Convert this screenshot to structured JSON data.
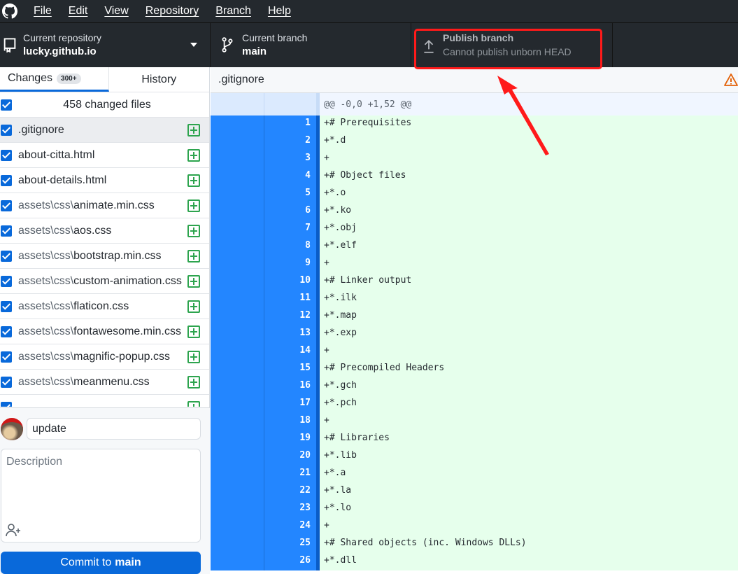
{
  "menu": [
    "File",
    "Edit",
    "View",
    "Repository",
    "Branch",
    "Help"
  ],
  "toolbar": {
    "repo": {
      "label": "Current repository",
      "value": "lucky.github.io"
    },
    "branch": {
      "label": "Current branch",
      "value": "main"
    },
    "publish": {
      "label": "Publish branch",
      "sub": "Cannot publish unborn HEAD"
    }
  },
  "tabs": {
    "changes": "Changes",
    "changes_badge": "300+",
    "history": "History"
  },
  "changed_summary": "458 changed files",
  "files": [
    {
      "path": "",
      "name": ".gitignore",
      "selected": true
    },
    {
      "path": "",
      "name": "about-citta.html"
    },
    {
      "path": "",
      "name": "about-details.html"
    },
    {
      "path": "assets\\css\\",
      "name": "animate.min.css"
    },
    {
      "path": "assets\\css\\",
      "name": "aos.css"
    },
    {
      "path": "assets\\css\\",
      "name": "bootstrap.min.css"
    },
    {
      "path": "assets\\css\\",
      "name": "custom-animation.css"
    },
    {
      "path": "assets\\css\\",
      "name": "flaticon.css"
    },
    {
      "path": "assets\\css\\",
      "name": "fontawesome.min.css"
    },
    {
      "path": "assets\\css\\",
      "name": "magnific-popup.css"
    },
    {
      "path": "assets\\css\\",
      "name": "meanmenu.css"
    },
    {
      "path": "",
      "name": ""
    }
  ],
  "commit": {
    "summary": "update",
    "description_placeholder": "Description",
    "button_prefix": "Commit to",
    "button_branch": "main"
  },
  "diff": {
    "file": ".gitignore",
    "hunk": "@@ -0,0 +1,52 @@",
    "lines": [
      "+# Prerequisites",
      "+*.d",
      "+",
      "+# Object files",
      "+*.o",
      "+*.ko",
      "+*.obj",
      "+*.elf",
      "+",
      "+# Linker output",
      "+*.ilk",
      "+*.map",
      "+*.exp",
      "+",
      "+# Precompiled Headers",
      "+*.gch",
      "+*.pch",
      "+",
      "+# Libraries",
      "+*.lib",
      "+*.a",
      "+*.la",
      "+*.lo",
      "+",
      "+# Shared objects (inc. Windows DLLs)",
      "+*.dll"
    ]
  },
  "colors": {
    "accent": "#0969da",
    "added": "#2da44e",
    "annotation": "#ff1a1a",
    "warning": "#e36209"
  }
}
